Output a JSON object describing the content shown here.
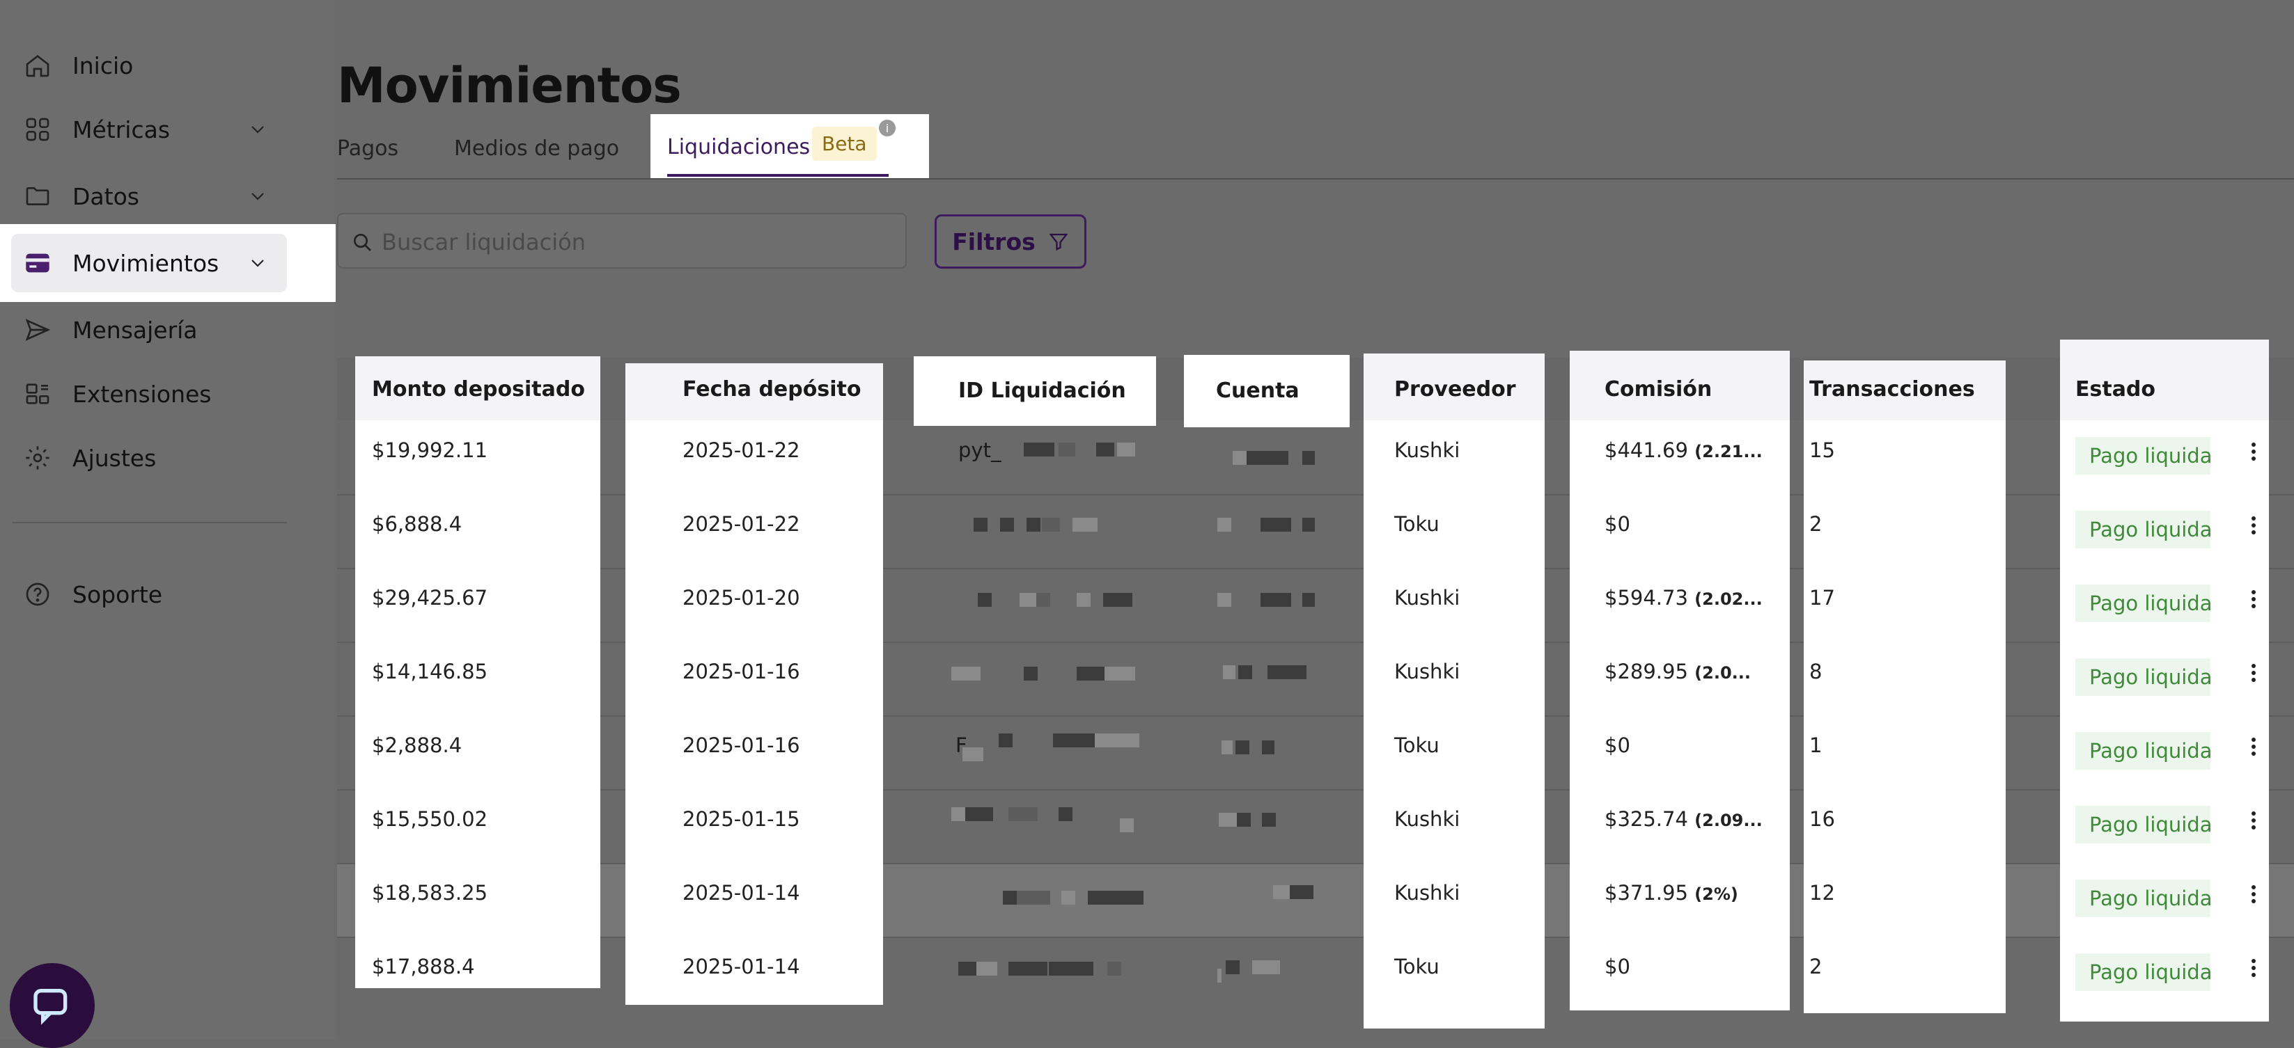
{
  "sidebar": {
    "items": [
      {
        "label": "Inicio",
        "icon": "home-icon"
      },
      {
        "label": "Métricas",
        "icon": "grid-icon"
      },
      {
        "label": "Datos",
        "icon": "folder-icon"
      },
      {
        "label": "Movimientos",
        "icon": "card-icon"
      },
      {
        "label": "Mensajería",
        "icon": "send-icon"
      },
      {
        "label": "Extensiones",
        "icon": "extensions-icon"
      },
      {
        "label": "Ajustes",
        "icon": "gear-icon"
      }
    ],
    "support": {
      "label": "Soporte",
      "icon": "help-icon"
    }
  },
  "page": {
    "title": "Movimientos"
  },
  "tabs": [
    {
      "label": "Pagos"
    },
    {
      "label": "Medios de pago"
    },
    {
      "label": "Liquidaciones",
      "badge": "Beta",
      "active": true
    }
  ],
  "search": {
    "placeholder": "Buscar liquidación"
  },
  "filters": {
    "label": "Filtros"
  },
  "table": {
    "headers": [
      "Monto depositado",
      "Fecha depósito",
      "ID Liquidación",
      "Cuenta",
      "Proveedor",
      "Comisión",
      "Transacciones",
      "Estado"
    ],
    "rows": [
      {
        "monto": "$19,992.11",
        "fecha": "2025-01-22",
        "id": "pyt_",
        "proveedor": "Kushki",
        "comision": "$441.69",
        "comision_pct": "(2.21...",
        "transacciones": "15",
        "estado": "Pago liquida"
      },
      {
        "monto": "$6,888.4",
        "fecha": "2025-01-22",
        "id": "",
        "proveedor": "Toku",
        "comision": "$0",
        "comision_pct": "",
        "transacciones": "2",
        "estado": "Pago liquida"
      },
      {
        "monto": "$29,425.67",
        "fecha": "2025-01-20",
        "id": "",
        "proveedor": "Kushki",
        "comision": "$594.73",
        "comision_pct": "(2.02...",
        "transacciones": "17",
        "estado": "Pago liquida"
      },
      {
        "monto": "$14,146.85",
        "fecha": "2025-01-16",
        "id": "",
        "proveedor": "Kushki",
        "comision": "$289.95",
        "comision_pct": "(2.0...",
        "transacciones": "8",
        "estado": "Pago liquida"
      },
      {
        "monto": "$2,888.4",
        "fecha": "2025-01-16",
        "id": "F",
        "proveedor": "Toku",
        "comision": "$0",
        "comision_pct": "",
        "transacciones": "1",
        "estado": "Pago liquida"
      },
      {
        "monto": "$15,550.02",
        "fecha": "2025-01-15",
        "id": "",
        "proveedor": "Kushki",
        "comision": "$325.74",
        "comision_pct": "(2.09...",
        "transacciones": "16",
        "estado": "Pago liquida"
      },
      {
        "monto": "$18,583.25",
        "fecha": "2025-01-14",
        "id": "",
        "proveedor": "Kushki",
        "comision": "$371.95",
        "comision_pct": "(2%)",
        "transacciones": "12",
        "estado": "Pago liquida"
      },
      {
        "monto": "$17,888.4",
        "fecha": "2025-01-14",
        "id": "",
        "proveedor": "Toku",
        "comision": "$0",
        "comision_pct": "",
        "transacciones": "2",
        "estado": "Pago liquida"
      }
    ]
  },
  "colors": {
    "brand": "#3d1b5e",
    "status_bg": "#edf6ec",
    "status_text": "#3f8a3a",
    "beta_bg": "#fbf3d4"
  }
}
